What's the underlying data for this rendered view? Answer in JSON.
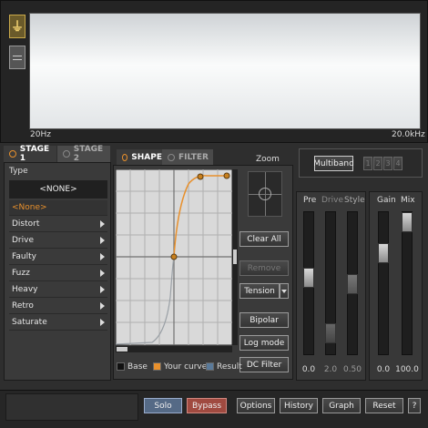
{
  "spectrum": {
    "min_label": "20Hz",
    "max_label": "20.0kHz"
  },
  "stages": {
    "stage1": "STAGE 1",
    "stage2": "STAGE 2"
  },
  "type_panel": {
    "type_label": "Type",
    "none_header": "<NONE>",
    "selected": "<None>",
    "items": [
      "Distort",
      "Drive",
      "Faulty",
      "Fuzz",
      "Heavy",
      "Retro",
      "Saturate"
    ]
  },
  "shape_tabs": {
    "shape": "SHAPE",
    "filter": "FILTER"
  },
  "zoom": {
    "label": "Zoom"
  },
  "curve_buttons": {
    "clear_all": "Clear All",
    "remove": "Remove",
    "tension": "Tension",
    "bipolar": "Bipolar",
    "log_mode": "Log mode",
    "dc_filter": "DC Filter"
  },
  "legend": {
    "base": "Base",
    "your_curve": "Your curve",
    "result": "Result"
  },
  "multiband": {
    "label": "Multiband",
    "bands": [
      "1",
      "2",
      "3",
      "4"
    ]
  },
  "mixer": {
    "pre": {
      "label": "Pre",
      "value": "0.0",
      "level": 0.55
    },
    "drive": {
      "label": "Drive",
      "value": "2.0",
      "level": 0.1
    },
    "style": {
      "label": "Style",
      "value": "0.50",
      "level": 0.5
    },
    "gain": {
      "label": "Gain",
      "value": "0.0",
      "level": 0.75
    },
    "mix": {
      "label": "Mix",
      "value": "100.0",
      "level": 1.0
    }
  },
  "bottom_bar": {
    "solo": "Solo",
    "bypass": "Bypass",
    "options": "Options",
    "history": "History",
    "graph": "Graph",
    "reset": "Reset",
    "help": "?"
  },
  "colors": {
    "accent": "#e8902c",
    "bypass": "#a04a40",
    "solo": "#556a86"
  }
}
